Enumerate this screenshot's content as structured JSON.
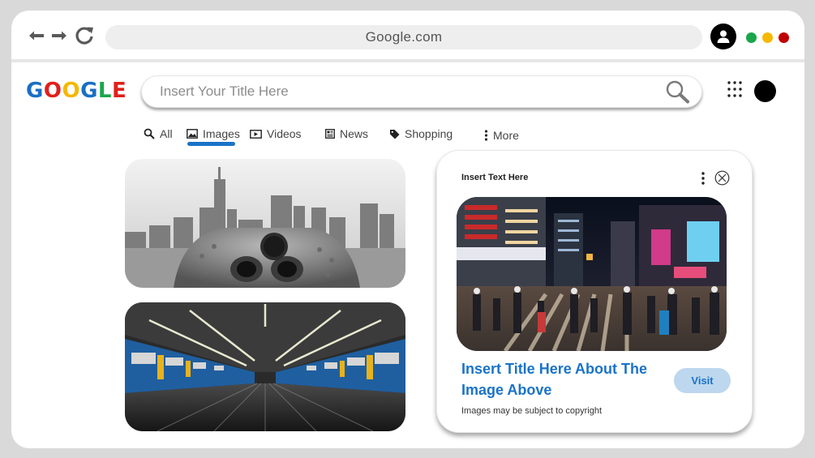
{
  "browser": {
    "url": "Google.com",
    "window_dots": [
      "#1aa64b",
      "#f5b800",
      "#c00000"
    ]
  },
  "header": {
    "logo_letters": [
      {
        "char": "G",
        "color": "#1a6fc4"
      },
      {
        "char": "O",
        "color": "#e0201b"
      },
      {
        "char": "O",
        "color": "#f5b800"
      },
      {
        "char": "G",
        "color": "#1a6fc4"
      },
      {
        "char": "L",
        "color": "#1aa64b"
      },
      {
        "char": "E",
        "color": "#e0201b"
      }
    ],
    "search_placeholder": "Insert Your Title Here"
  },
  "tabs": [
    {
      "label": "All",
      "icon": "search-icon"
    },
    {
      "label": "Images",
      "icon": "image-icon",
      "active": true
    },
    {
      "label": "Videos",
      "icon": "video-icon"
    },
    {
      "label": "News",
      "icon": "news-icon"
    },
    {
      "label": "Shopping",
      "icon": "tag-icon"
    },
    {
      "label": "More",
      "icon": "more-vertical-icon"
    }
  ],
  "preview": {
    "heading": "Insert Text Here",
    "title": "Insert Title Here About The Image Above",
    "visit_label": "Visit",
    "copyright": "Images may be subject to copyright"
  },
  "colors": {
    "accent": "#1a73c8",
    "visit_bg": "#bdd7ee"
  }
}
